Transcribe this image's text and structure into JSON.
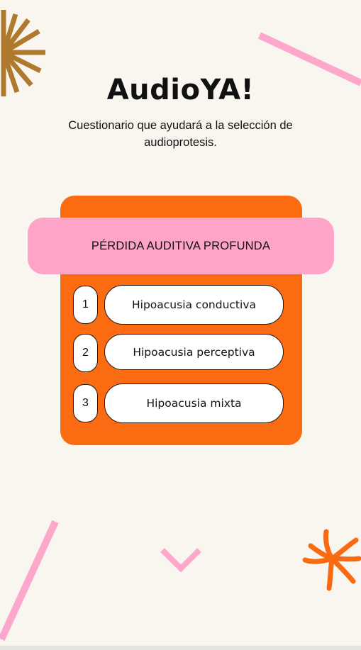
{
  "app": {
    "title": "AudioYA!",
    "subtitle": "Cuestionario que ayudará a la selección de audioprotesis."
  },
  "question": {
    "label": "PÉRDIDA AUDITIVA PROFUNDA"
  },
  "options": [
    {
      "number": "1",
      "label": "Hipoacusia conductiva"
    },
    {
      "number": "2",
      "label": "Hipoacusia perceptiva"
    },
    {
      "number": "3",
      "label": "Hipoacusia mixta"
    }
  ],
  "navigation": {
    "next_icon": "chevron-down-icon"
  },
  "colors": {
    "background": "#f8f6ee",
    "card_orange": "#fb6b12",
    "banner_pink": "#fea4c8",
    "accent_pink": "#fda7cc",
    "starburst_brown": "#b07a2e",
    "asterisk_orange": "#f96a12"
  }
}
